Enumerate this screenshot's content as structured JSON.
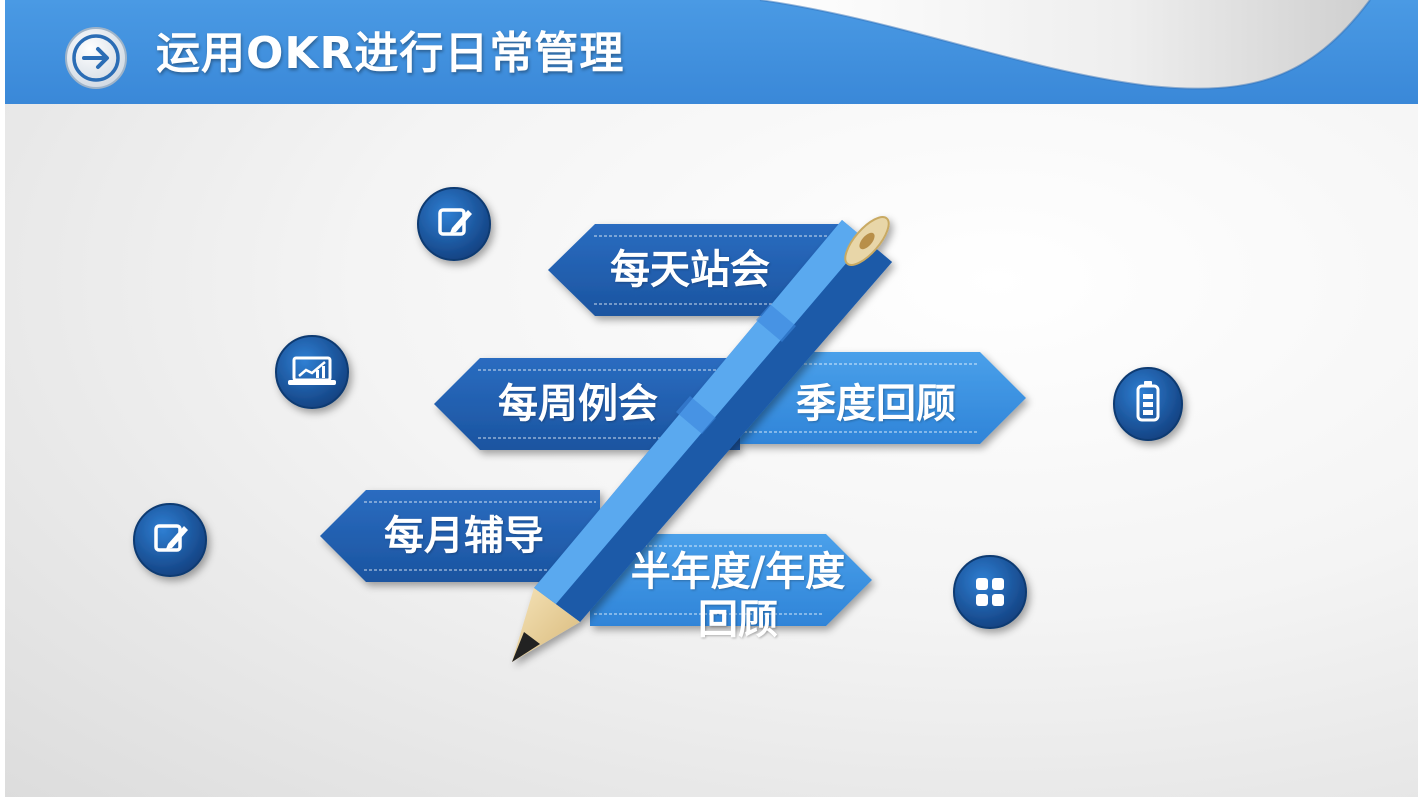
{
  "header": {
    "title": "运用OKR进行日常管理",
    "icon": "arrow-right-icon",
    "color": "#3d8fdc"
  },
  "items": [
    {
      "label": "每天站会"
    },
    {
      "label": "每周例会"
    },
    {
      "label": "季度回顾"
    },
    {
      "label": "每月辅导"
    },
    {
      "label_line1": "半年度/年度",
      "label_line2": "回顾"
    }
  ],
  "icons": [
    {
      "name": "edit-icon"
    },
    {
      "name": "laptop-chart-icon"
    },
    {
      "name": "edit-icon"
    },
    {
      "name": "battery-icon"
    },
    {
      "name": "grid-apps-icon"
    }
  ],
  "colors": {
    "banner_dark": "#1f5fa8",
    "banner_light": "#3d8fdc",
    "pencil_blue": "#2e7fd6",
    "icon_circle": "#1c5aa6"
  }
}
